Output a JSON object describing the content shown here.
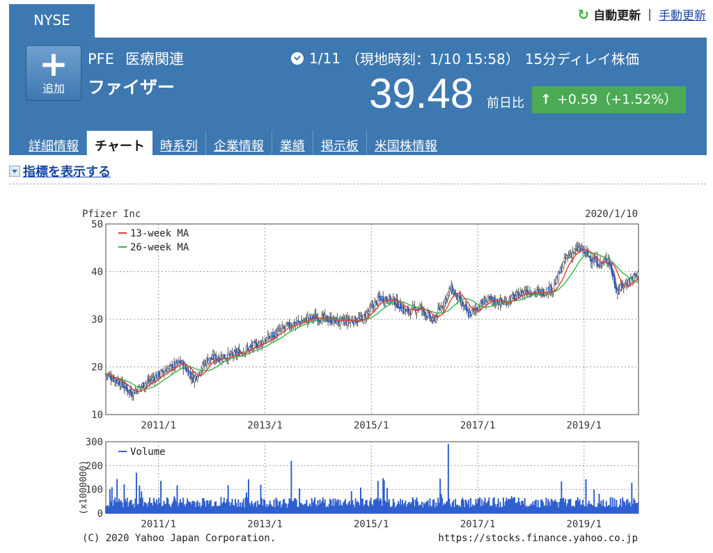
{
  "market": "NYSE",
  "refresh": {
    "auto_label": "自動更新",
    "separator": "|",
    "manual_label": "手動更新"
  },
  "stock": {
    "ticker": "PFE",
    "sector": "医療関連",
    "name": "ファイザー",
    "date": "1/11",
    "local_time": "（現地時刻：1/10 15:58）",
    "delay_note": "15分ディレイ株価",
    "price": "39.48",
    "diff_label": "前日比",
    "change": "+0.59（+1.52%）",
    "change_direction": "up"
  },
  "add_button": {
    "plus": "+",
    "label": "追加"
  },
  "tabs": [
    {
      "label": "詳細情報",
      "active": false
    },
    {
      "label": "チャート",
      "active": true
    },
    {
      "label": "時系列",
      "active": false
    },
    {
      "label": "企業情報",
      "active": false
    },
    {
      "label": "業績",
      "active": false
    },
    {
      "label": "掲示板",
      "active": false
    },
    {
      "label": "米国株情報",
      "active": false
    }
  ],
  "indicator_link": "指標を表示する",
  "colors": {
    "header_bg": "#3d78b0",
    "up_green": "#4caa55",
    "link_blue": "#1747a6",
    "candle_blue": "#2f5fd0",
    "ma13_red": "#e0392a",
    "ma26_green": "#33b24a",
    "volume_blue": "#2f5fd0"
  },
  "chart_data": [
    {
      "type": "candlestick",
      "title": "Pfizer Inc",
      "date_label": "2020/1/10",
      "ylim": [
        10,
        50
      ],
      "yticks": [
        10,
        20,
        30,
        40,
        50
      ],
      "xlim": [
        "2010-01-04",
        "2020-01-10"
      ],
      "xticks": [
        {
          "label": "2011/1",
          "date": "2011-01-01"
        },
        {
          "label": "2013/1",
          "date": "2013-01-01"
        },
        {
          "label": "2015/1",
          "date": "2015-01-01"
        },
        {
          "label": "2017/1",
          "date": "2017-01-01"
        },
        {
          "label": "2019/1",
          "date": "2019-01-01"
        }
      ],
      "grid": true,
      "legend_position": "top-left",
      "legend": [
        "13-week MA",
        "26-week MA"
      ],
      "weekly_close_keypoints": [
        {
          "date": "2010-01-04",
          "close": 18.5
        },
        {
          "date": "2010-04-01",
          "close": 17.0
        },
        {
          "date": "2010-07-01",
          "close": 14.5
        },
        {
          "date": "2010-10-01",
          "close": 16.5
        },
        {
          "date": "2011-03-01",
          "close": 19.5
        },
        {
          "date": "2011-06-01",
          "close": 21.0
        },
        {
          "date": "2011-09-01",
          "close": 17.5
        },
        {
          "date": "2011-12-01",
          "close": 21.5
        },
        {
          "date": "2012-06-01",
          "close": 22.5
        },
        {
          "date": "2012-12-01",
          "close": 25.0
        },
        {
          "date": "2013-06-01",
          "close": 28.5
        },
        {
          "date": "2013-12-01",
          "close": 30.5
        },
        {
          "date": "2014-06-01",
          "close": 29.5
        },
        {
          "date": "2014-11-01",
          "close": 30.0
        },
        {
          "date": "2015-03-01",
          "close": 34.5
        },
        {
          "date": "2015-06-01",
          "close": 34.0
        },
        {
          "date": "2015-09-01",
          "close": 31.5
        },
        {
          "date": "2015-12-01",
          "close": 32.5
        },
        {
          "date": "2016-03-01",
          "close": 29.5
        },
        {
          "date": "2016-07-01",
          "close": 36.5
        },
        {
          "date": "2016-11-01",
          "close": 31.0
        },
        {
          "date": "2017-03-01",
          "close": 34.0
        },
        {
          "date": "2017-07-01",
          "close": 33.5
        },
        {
          "date": "2017-12-01",
          "close": 36.0
        },
        {
          "date": "2018-03-01",
          "close": 35.5
        },
        {
          "date": "2018-06-01",
          "close": 36.5
        },
        {
          "date": "2018-09-01",
          "close": 43.0
        },
        {
          "date": "2018-12-01",
          "close": 45.0
        },
        {
          "date": "2019-03-01",
          "close": 42.5
        },
        {
          "date": "2019-05-01",
          "close": 41.5
        },
        {
          "date": "2019-06-15",
          "close": 43.0
        },
        {
          "date": "2019-08-15",
          "close": 36.0
        },
        {
          "date": "2019-11-01",
          "close": 38.0
        },
        {
          "date": "2020-01-10",
          "close": 39.5
        }
      ]
    },
    {
      "type": "bar",
      "title": "Volume",
      "ylabel": "(x1000000)",
      "ylim": [
        0,
        300
      ],
      "yticks": [
        0,
        100,
        200,
        300
      ],
      "legend": [
        "Volume"
      ],
      "typical_weekly_volume": 40,
      "notable_peaks": [
        {
          "date": "2013-07-01",
          "value": 220
        },
        {
          "date": "2016-06-15",
          "value": 290
        },
        {
          "date": "2016-04-15",
          "value": 145
        },
        {
          "date": "2010-08-01",
          "value": 170
        }
      ]
    }
  ],
  "footer": {
    "copyright": "(C) 2020 Yahoo Japan Corporation.",
    "url": "https://stocks.finance.yahoo.co.jp"
  }
}
